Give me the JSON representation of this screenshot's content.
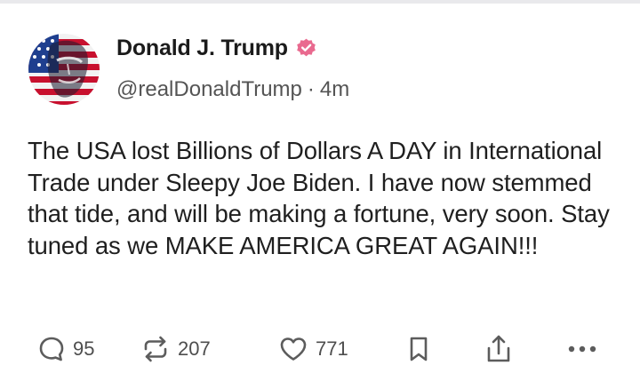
{
  "post": {
    "author_name": "Donald J. Trump",
    "handle": "@realDonaldTrump",
    "separator": "·",
    "time_ago": "4m",
    "text": "The USA lost Billions of Dollars A DAY in International Trade under Sleepy Joe Biden. I have now stemmed that tide, and will be making a fortune, very soon. Stay tuned as we MAKE AMERICA GREAT AGAIN!!!"
  },
  "actions": {
    "reply_count": "95",
    "repost_count": "207",
    "like_count": "771"
  },
  "icons": {
    "reply": "reply-icon",
    "repost": "repost-icon",
    "like": "heart-icon",
    "bookmark": "bookmark-icon",
    "share": "share-icon",
    "more": "more-options-icon",
    "verified": "verified-badge-icon"
  },
  "colors": {
    "verified_badge": "#e96a8f",
    "text": "#1f1f1f",
    "secondary": "#545454"
  }
}
